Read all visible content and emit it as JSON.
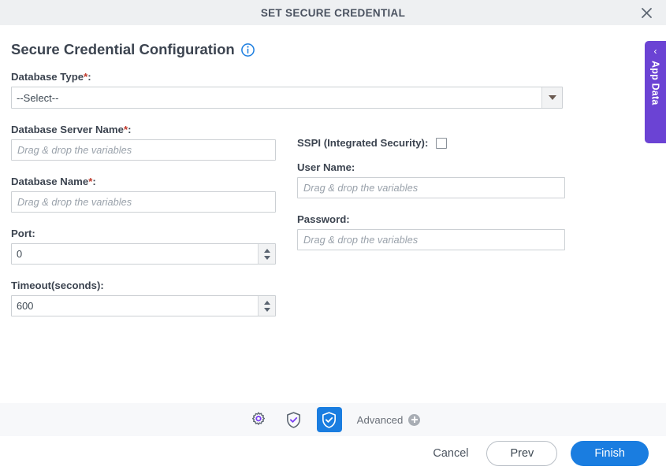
{
  "titlebar": {
    "title": "SET SECURE CREDENTIAL",
    "close_icon": "close-icon"
  },
  "header": {
    "page_title": "Secure Credential Configuration",
    "info_icon": "info-icon"
  },
  "form": {
    "database_type": {
      "label": "Database Type",
      "required": "*",
      "suffix": ":",
      "value": "--Select--",
      "arrow_icon": "chevron-down-icon"
    },
    "database_server_name": {
      "label": "Database Server Name",
      "required": "*",
      "suffix": ":",
      "value": "",
      "placeholder": "Drag & drop the variables"
    },
    "sspi": {
      "label": "SSPI (Integrated Security):",
      "checked": false
    },
    "database_name": {
      "label": "Database Name",
      "required": "*",
      "suffix": ":",
      "value": "",
      "placeholder": "Drag & drop the variables"
    },
    "user_name": {
      "label": "User Name:",
      "value": "",
      "placeholder": "Drag & drop the variables"
    },
    "port": {
      "label": "Port:",
      "value": "0"
    },
    "password": {
      "label": "Password:",
      "value": "",
      "placeholder": "Drag & drop the variables"
    },
    "timeout": {
      "label": "Timeout(seconds):",
      "value": "600"
    }
  },
  "toolbar": {
    "items": [
      {
        "name": "gear-icon",
        "active": false
      },
      {
        "name": "shield-check-outline-icon",
        "active": false
      },
      {
        "name": "shield-check-icon",
        "active": true
      }
    ],
    "advanced_label": "Advanced",
    "advanced_plus_icon": "plus-circle-icon"
  },
  "actions": {
    "cancel": "Cancel",
    "prev": "Prev",
    "finish": "Finish"
  },
  "side_tab": {
    "label": "App Data",
    "chevron": "‹"
  },
  "colors": {
    "accent_blue": "#1a7de0",
    "purple": "#6b43d4",
    "titlebar_bg": "#eef0f2",
    "toolbar_bg": "#f7f8fa",
    "required_red": "#c0392b"
  }
}
